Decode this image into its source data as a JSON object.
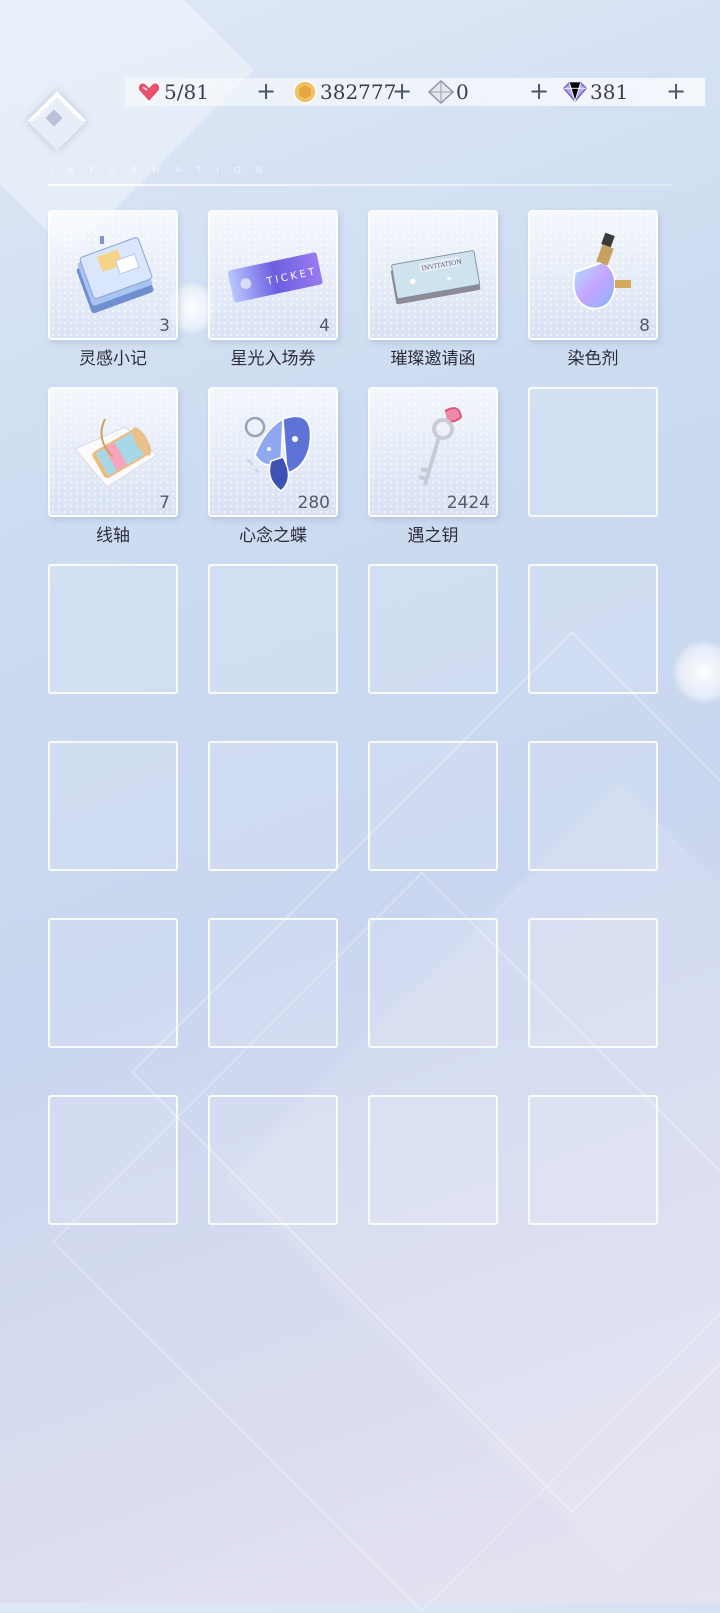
{
  "resources": [
    {
      "name": "heart-energy",
      "icon": "heart-crystal-icon",
      "value": "5/81"
    },
    {
      "name": "gold-coin",
      "icon": "gold-coin-icon",
      "value": "382777"
    },
    {
      "name": "crystal",
      "icon": "silver-crystal-icon",
      "value": "0"
    },
    {
      "name": "diamond",
      "icon": "diamond-icon",
      "value": "381"
    }
  ],
  "header": {
    "back_icon": "back-diamond-icon"
  },
  "items": [
    {
      "name": "灵感小记",
      "count": "3",
      "icon": "notebook-icon"
    },
    {
      "name": "星光入场券",
      "count": "4",
      "icon": "ticket-icon"
    },
    {
      "name": "璀璨邀请函",
      "count": "",
      "icon": "invitation-icon"
    },
    {
      "name": "染色剂",
      "count": "8",
      "icon": "dye-bottle-icon"
    },
    {
      "name": "线轴",
      "count": "7",
      "icon": "thread-spool-icon"
    },
    {
      "name": "心念之蝶",
      "count": "280",
      "icon": "butterfly-icon"
    },
    {
      "name": "遇之钥",
      "count": "2424",
      "icon": "key-icon"
    }
  ],
  "empty_slots": 17,
  "colors": {
    "accent": "#c9d6ef",
    "text": "#2f2d3a"
  }
}
